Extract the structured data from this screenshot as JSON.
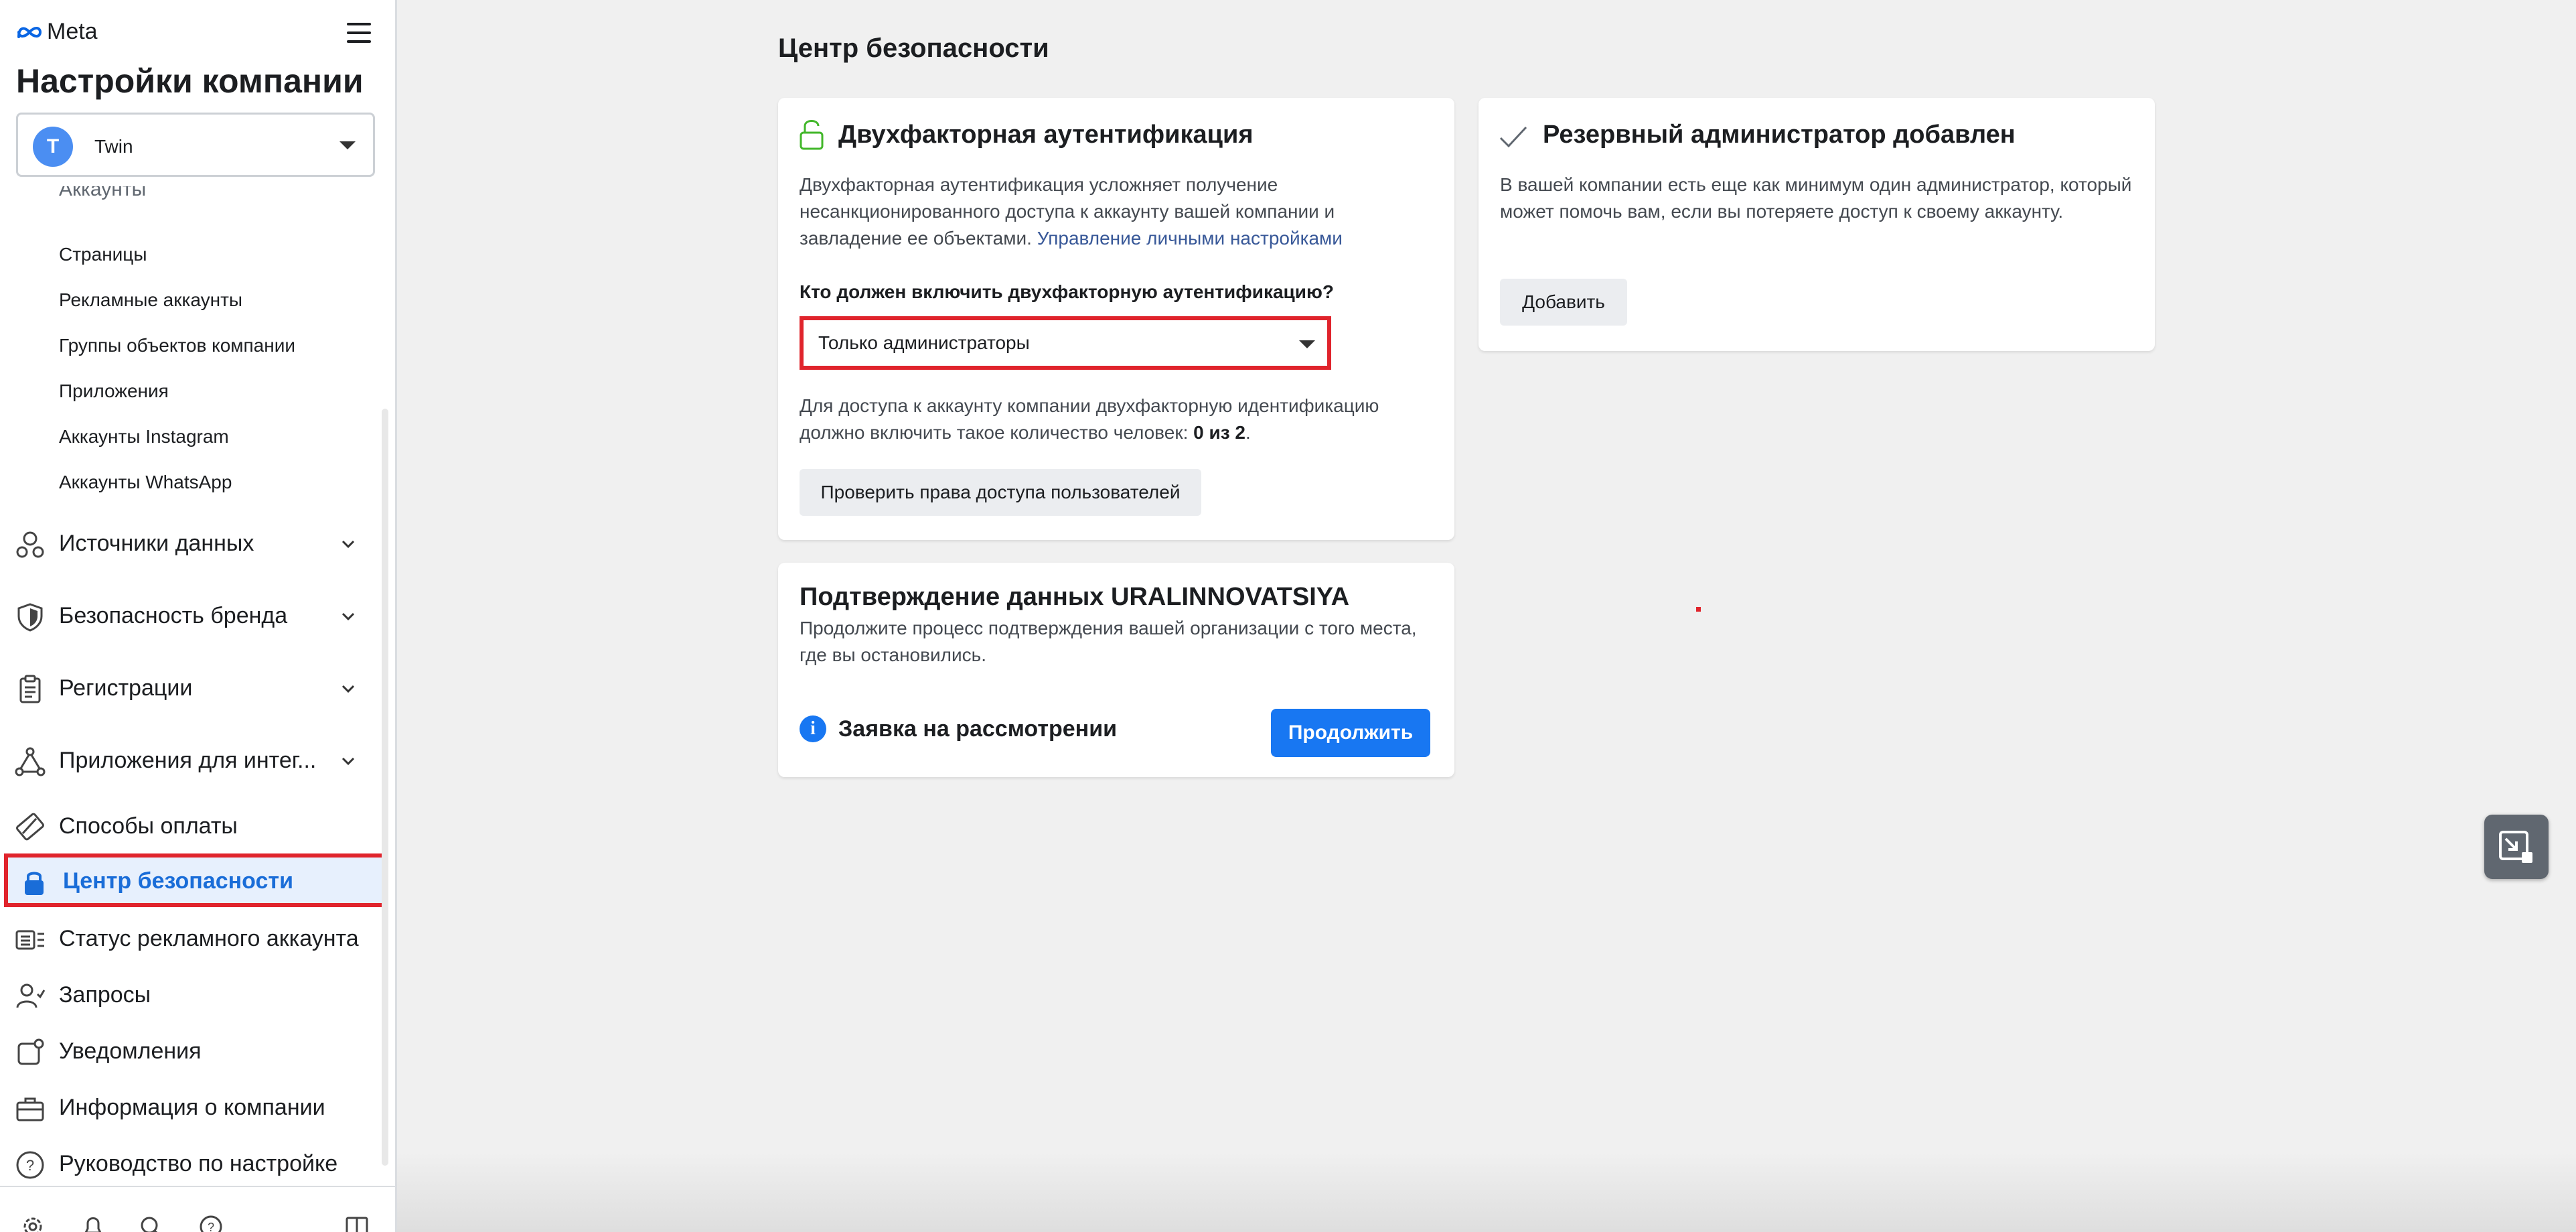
{
  "sidebar": {
    "brand": "Meta",
    "title": "Настройки компании",
    "account": {
      "initial": "T",
      "name": "Twin"
    },
    "clipped_heading": "Аккаунты",
    "sub_items": [
      "Страницы",
      "Рекламные аккаунты",
      "Группы объектов компании",
      "Приложения",
      "Аккаунты Instagram",
      "Аккаунты WhatsApp"
    ],
    "nav": [
      {
        "label": "Источники данных",
        "icon": "data-sources-icon",
        "expandable": true
      },
      {
        "label": "Безопасность бренда",
        "icon": "shield-icon",
        "expandable": true
      },
      {
        "label": "Регистрации",
        "icon": "clipboard-icon",
        "expandable": true
      },
      {
        "label": "Приложения для интег...",
        "icon": "integrations-icon",
        "expandable": true
      },
      {
        "label": "Способы оплаты",
        "icon": "card-icon",
        "expandable": false
      },
      {
        "label": "Центр безопасности",
        "icon": "lock-icon",
        "expandable": false,
        "active": true
      },
      {
        "label": "Статус рекламного аккаунта",
        "icon": "ad-status-icon",
        "expandable": false
      },
      {
        "label": "Запросы",
        "icon": "user-check-icon",
        "expandable": false
      },
      {
        "label": "Уведомления",
        "icon": "notification-icon",
        "expandable": false
      },
      {
        "label": "Информация о компании",
        "icon": "briefcase-icon",
        "expandable": false
      },
      {
        "label": "Руководство по настройке",
        "icon": "help-icon",
        "expandable": false
      }
    ],
    "bottom_icons": [
      "settings-icon",
      "bell-icon",
      "search-icon",
      "help-icon",
      "panel-icon"
    ]
  },
  "main": {
    "page_title": "Центр безопасности",
    "two_factor": {
      "title": "Двухфакторная аутентификация",
      "description": "Двухфакторная аутентификация усложняет получение несанкционированного доступа к аккаунту вашей компании и завладение ее объектами.",
      "link": "Управление личными настройками",
      "question": "Кто должен включить двухфакторную аутентификацию?",
      "selected_option": "Только администраторы",
      "count_text": "Для доступа к аккаунту компании двухфакторную идентификацию должно включить такое количество человек:",
      "count_value": "0 из 2",
      "check_button": "Проверить права доступа пользователей"
    },
    "backup_admin": {
      "title": "Резервный администратор добавлен",
      "description": "В вашей компании есть еще как минимум один администратор, который может помочь вам, если вы потеряете доступ к своему аккаунту.",
      "add_button": "Добавить"
    },
    "verification": {
      "title": "Подтверждение данных URALINNOVATSIYA",
      "description": "Продолжите процесс подтверждения вашей организации с того места, где вы остановились.",
      "status": "Заявка на рассмотрении",
      "continue_button": "Продолжить"
    }
  },
  "colors": {
    "accent": "#1877f2",
    "highlight": "#e0242c",
    "active_bg": "#e7f0fd"
  }
}
